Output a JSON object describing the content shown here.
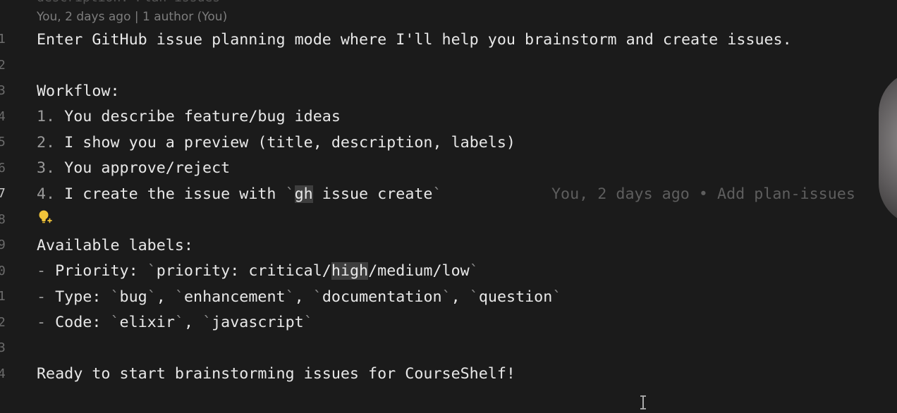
{
  "codelens": "You, 2 days ago | 1 author (You)",
  "top_cut_text": "description: Plan issues",
  "gutter": [
    "1",
    "2",
    "3",
    "4",
    "5",
    "6",
    "7",
    "8",
    "9",
    "0",
    "1",
    "2",
    "3",
    "4"
  ],
  "lines": {
    "l1": "Enter GitHub issue planning mode where I'll help you brainstorm and create issues.",
    "l3": "Workflow:",
    "l4_num": "1.",
    "l4_text": " You describe feature/bug ideas",
    "l5_num": "2.",
    "l5_text": " I show you a preview (title, description, labels)",
    "l6_num": "3.",
    "l6_text": " You approve/reject",
    "l7_num": "4.",
    "l7_a": " I create the issue with ",
    "l7_tick1": "`",
    "l7_hl": "gh",
    "l7_b": " issue create",
    "l7_tick2": "`",
    "l9": "Available labels:",
    "l10_dash": "-",
    "l10_a": " Priority: ",
    "l10_t1": "`",
    "l10_b": "priority: critical/",
    "l10_hl": "high",
    "l10_c": "/medium/low",
    "l10_t2": "`",
    "l11_dash": "-",
    "l11_a": " Type: ",
    "l11_t1": "`",
    "l11_b": "bug",
    "l11_t2": "`",
    "l11_c": ", ",
    "l11_t3": "`",
    "l11_d": "enhancement",
    "l11_t4": "`",
    "l11_e": ", ",
    "l11_t5": "`",
    "l11_f": "documentation",
    "l11_t6": "`",
    "l11_g": ", ",
    "l11_t7": "`",
    "l11_h": "question",
    "l11_t8": "`",
    "l12_dash": "-",
    "l12_a": " Code: ",
    "l12_t1": "`",
    "l12_b": "elixir",
    "l12_t2": "`",
    "l12_c": ", ",
    "l12_t3": "`",
    "l12_d": "javascript",
    "l12_t4": "`",
    "l14": "Ready to start brainstorming issues for CourseShelf!"
  },
  "blame": "You, 2 days ago • Add plan-issues",
  "icons": {
    "lightbulb": "lightbulb-icon",
    "cursor": "text-cursor-icon"
  },
  "colors": {
    "background": "#1b1b1b",
    "text": "#e8e8e8",
    "dim": "#7d7d7d",
    "highlight": "#3e3e3e",
    "bulb": "#f0c43a"
  }
}
